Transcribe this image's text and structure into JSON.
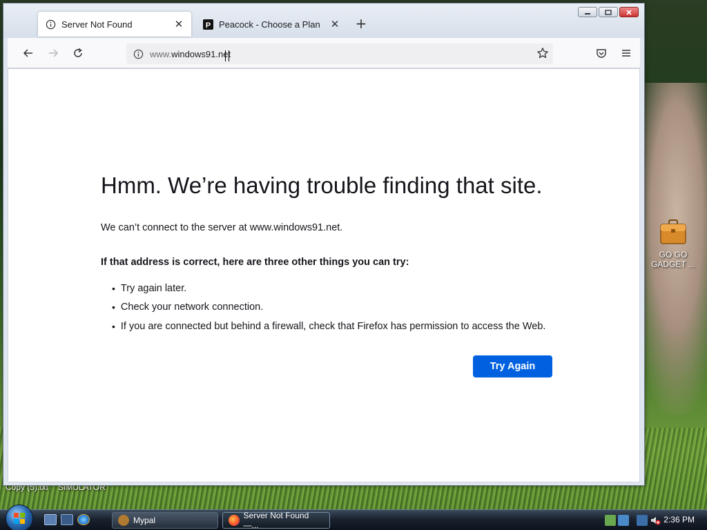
{
  "browser": {
    "tabs": [
      {
        "label": "Server Not Found",
        "icon": "info-icon",
        "active": true
      },
      {
        "label": "Peacock - Choose a Plan",
        "icon": "peacock-icon",
        "active": false
      }
    ],
    "url_prefix": "www.",
    "url_domain": "windows91.net",
    "icons": {
      "back": "back-arrow-icon",
      "forward": "forward-arrow-icon",
      "reload": "reload-icon",
      "bookmark": "star-icon",
      "pocket": "pocket-icon",
      "menu": "hamburger-menu-icon"
    }
  },
  "error_page": {
    "title": "Hmm. We’re having trouble finding that site.",
    "description": "We can’t connect to the server at www.windows91.net.",
    "subtitle": "If that address is correct, here are three other things you can try:",
    "suggestions": [
      "Try again later.",
      "Check your network connection.",
      "If you are connected but behind a firewall, check that Firefox has permission to access the Web."
    ],
    "button_label": "Try Again"
  },
  "desktop": {
    "icon_label_line1": "GO GO",
    "icon_label_line2": "GADGET ...",
    "bottom_text_1": "Copy (5).txt",
    "bottom_text_2": "SIMULATOR"
  },
  "taskbar": {
    "buttons": [
      {
        "label": "Mypal",
        "active": false
      },
      {
        "label": "Server Not Found —...",
        "active": true
      }
    ],
    "clock": "2:36 PM"
  },
  "colors": {
    "accent": "#0061e0",
    "text": "#15141a"
  }
}
